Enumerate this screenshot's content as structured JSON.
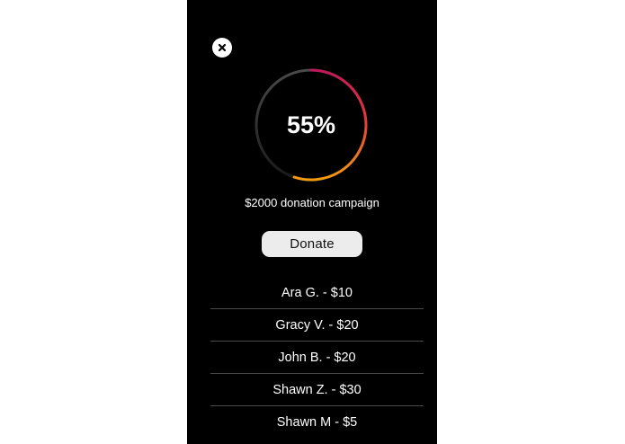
{
  "close": {
    "icon": "close-icon"
  },
  "progress": {
    "percent_label": "55%",
    "fraction": 0.55,
    "colors": {
      "start": "#c2185b",
      "mid": "#e53935",
      "end": "#f39c12",
      "track": "#3a3a3a"
    }
  },
  "campaign": {
    "label": "$2000 donation campaign"
  },
  "donate": {
    "label": "Donate"
  },
  "donors": [
    {
      "label": "Ara G. - $10"
    },
    {
      "label": "Gracy V. - $20"
    },
    {
      "label": "John B. - $20"
    },
    {
      "label": "Shawn Z. - $30"
    },
    {
      "label": "Shawn M - $5"
    }
  ]
}
